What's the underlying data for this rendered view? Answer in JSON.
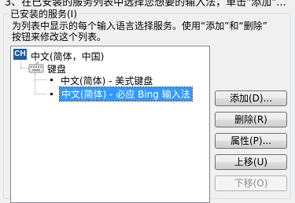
{
  "top_text": "3、在已安装的服务列表中选择您想要的输入法，单击\"添加\"...",
  "group": {
    "title": "已安装的服务(I)",
    "description_lines": [
      "为列表中显示的每个输入语言选择服务。使用“添加”和“删除”",
      "按钮来修改这个列表。"
    ]
  },
  "tree": {
    "language_badge": "CH",
    "language_label": "中文(简体，中国)",
    "category_label": "键盘",
    "services": [
      "中文(简体) - 美式键盘",
      "中文(简体) - 必应 Bing 输入法"
    ],
    "selected_index": 1
  },
  "buttons": {
    "add": "添加(D)...",
    "remove": "删除(R)",
    "properties": "属性(P)...",
    "move_up": "上移(U)",
    "move_down": "下移(O)"
  }
}
